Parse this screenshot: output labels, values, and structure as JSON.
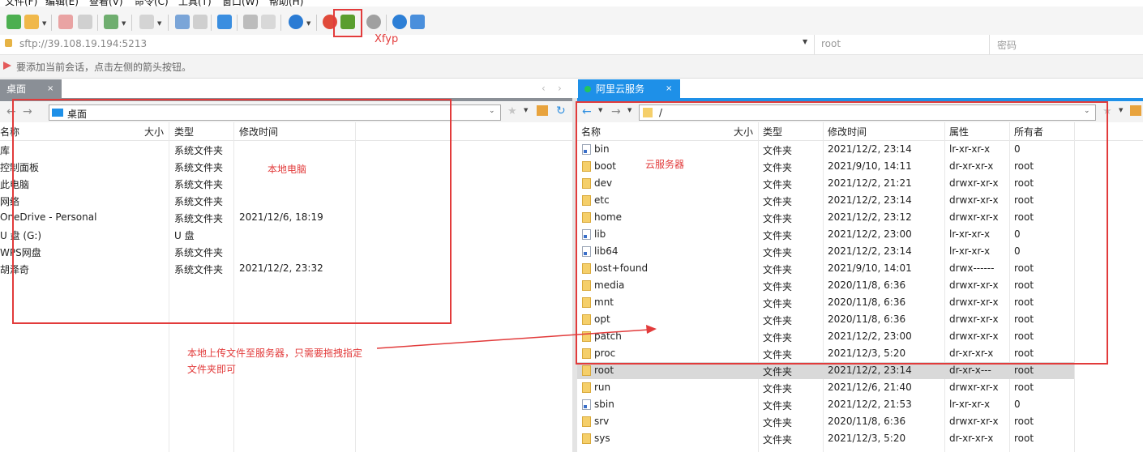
{
  "menu": [
    "文件(F)",
    "编辑(E)",
    "查看(V)",
    "命令(C)",
    "工具(T)",
    "窗口(W)",
    "帮助(H)"
  ],
  "toolbar": {
    "highlight_label": "Xfyp"
  },
  "address": {
    "url": "sftp://39.108.19.194:5213",
    "user_placeholder": "root",
    "password_placeholder": "密码"
  },
  "info_text": "要添加当前会话，点击左侧的箭头按钮。",
  "left_pane": {
    "tab_label": "桌面",
    "path": "桌面",
    "columns": [
      "名称",
      "大小",
      "类型",
      "修改时间"
    ],
    "rows": [
      {
        "name": "库",
        "size": "",
        "type": "系统文件夹",
        "modified": ""
      },
      {
        "name": "控制面板",
        "size": "",
        "type": "系统文件夹",
        "modified": ""
      },
      {
        "name": "此电脑",
        "size": "",
        "type": "系统文件夹",
        "modified": ""
      },
      {
        "name": "网络",
        "size": "",
        "type": "系统文件夹",
        "modified": ""
      },
      {
        "name": "OneDrive - Personal",
        "size": "",
        "type": "系统文件夹",
        "modified": "2021/12/6, 18:19"
      },
      {
        "name": "U 盘 (G:)",
        "size": "",
        "type": "U 盘",
        "modified": ""
      },
      {
        "name": "WPS网盘",
        "size": "",
        "type": "系统文件夹",
        "modified": ""
      },
      {
        "name": "胡泽奇",
        "size": "",
        "type": "系统文件夹",
        "modified": "2021/12/2, 23:32"
      }
    ]
  },
  "right_pane": {
    "tab_label": "阿里云服务",
    "path": "/",
    "columns": [
      "名称",
      "大小",
      "类型",
      "修改时间",
      "属性",
      "所有者"
    ],
    "selected_index": 13,
    "rows": [
      {
        "name": "bin",
        "kind": "link",
        "type": "文件夹",
        "modified": "2021/12/2, 23:14",
        "attr": "lr-xr-xr-x",
        "owner": "0"
      },
      {
        "name": "boot",
        "kind": "folder",
        "type": "文件夹",
        "modified": "2021/9/10, 14:11",
        "attr": "dr-xr-xr-x",
        "owner": "root"
      },
      {
        "name": "dev",
        "kind": "folder",
        "type": "文件夹",
        "modified": "2021/12/2, 21:21",
        "attr": "drwxr-xr-x",
        "owner": "root"
      },
      {
        "name": "etc",
        "kind": "folder",
        "type": "文件夹",
        "modified": "2021/12/2, 23:14",
        "attr": "drwxr-xr-x",
        "owner": "root"
      },
      {
        "name": "home",
        "kind": "folder",
        "type": "文件夹",
        "modified": "2021/12/2, 23:12",
        "attr": "drwxr-xr-x",
        "owner": "root"
      },
      {
        "name": "lib",
        "kind": "link",
        "type": "文件夹",
        "modified": "2021/12/2, 23:00",
        "attr": "lr-xr-xr-x",
        "owner": "0"
      },
      {
        "name": "lib64",
        "kind": "link",
        "type": "文件夹",
        "modified": "2021/12/2, 23:14",
        "attr": "lr-xr-xr-x",
        "owner": "0"
      },
      {
        "name": "lost+found",
        "kind": "folder",
        "type": "文件夹",
        "modified": "2021/9/10, 14:01",
        "attr": "drwx------",
        "owner": "root"
      },
      {
        "name": "media",
        "kind": "folder",
        "type": "文件夹",
        "modified": "2020/11/8, 6:36",
        "attr": "drwxr-xr-x",
        "owner": "root"
      },
      {
        "name": "mnt",
        "kind": "folder",
        "type": "文件夹",
        "modified": "2020/11/8, 6:36",
        "attr": "drwxr-xr-x",
        "owner": "root"
      },
      {
        "name": "opt",
        "kind": "folder",
        "type": "文件夹",
        "modified": "2020/11/8, 6:36",
        "attr": "drwxr-xr-x",
        "owner": "root"
      },
      {
        "name": "patch",
        "kind": "folder",
        "type": "文件夹",
        "modified": "2021/12/2, 23:00",
        "attr": "drwxr-xr-x",
        "owner": "root"
      },
      {
        "name": "proc",
        "kind": "folder",
        "type": "文件夹",
        "modified": "2021/12/3, 5:20",
        "attr": "dr-xr-xr-x",
        "owner": "root"
      },
      {
        "name": "root",
        "kind": "folder",
        "type": "文件夹",
        "modified": "2021/12/2, 23:14",
        "attr": "dr-xr-x---",
        "owner": "root"
      },
      {
        "name": "run",
        "kind": "folder",
        "type": "文件夹",
        "modified": "2021/12/6, 21:40",
        "attr": "drwxr-xr-x",
        "owner": "root"
      },
      {
        "name": "sbin",
        "kind": "link",
        "type": "文件夹",
        "modified": "2021/12/2, 21:53",
        "attr": "lr-xr-xr-x",
        "owner": "0"
      },
      {
        "name": "srv",
        "kind": "folder",
        "type": "文件夹",
        "modified": "2020/11/8, 6:36",
        "attr": "drwxr-xr-x",
        "owner": "root"
      },
      {
        "name": "sys",
        "kind": "folder",
        "type": "文件夹",
        "modified": "2021/12/3, 5:20",
        "attr": "dr-xr-xr-x",
        "owner": "root"
      }
    ]
  },
  "annotations": {
    "local": "本地电脑",
    "cloud": "云服务器",
    "upload_line1": "本地上传文件至服务器，只需要拖拽指定",
    "upload_line2": "文件夹即可"
  },
  "colors": {
    "accent": "#1e90e8",
    "annotation": "#e23b3b",
    "selected_row": "#d9d9d9",
    "connected_dot": "#22c55e"
  }
}
